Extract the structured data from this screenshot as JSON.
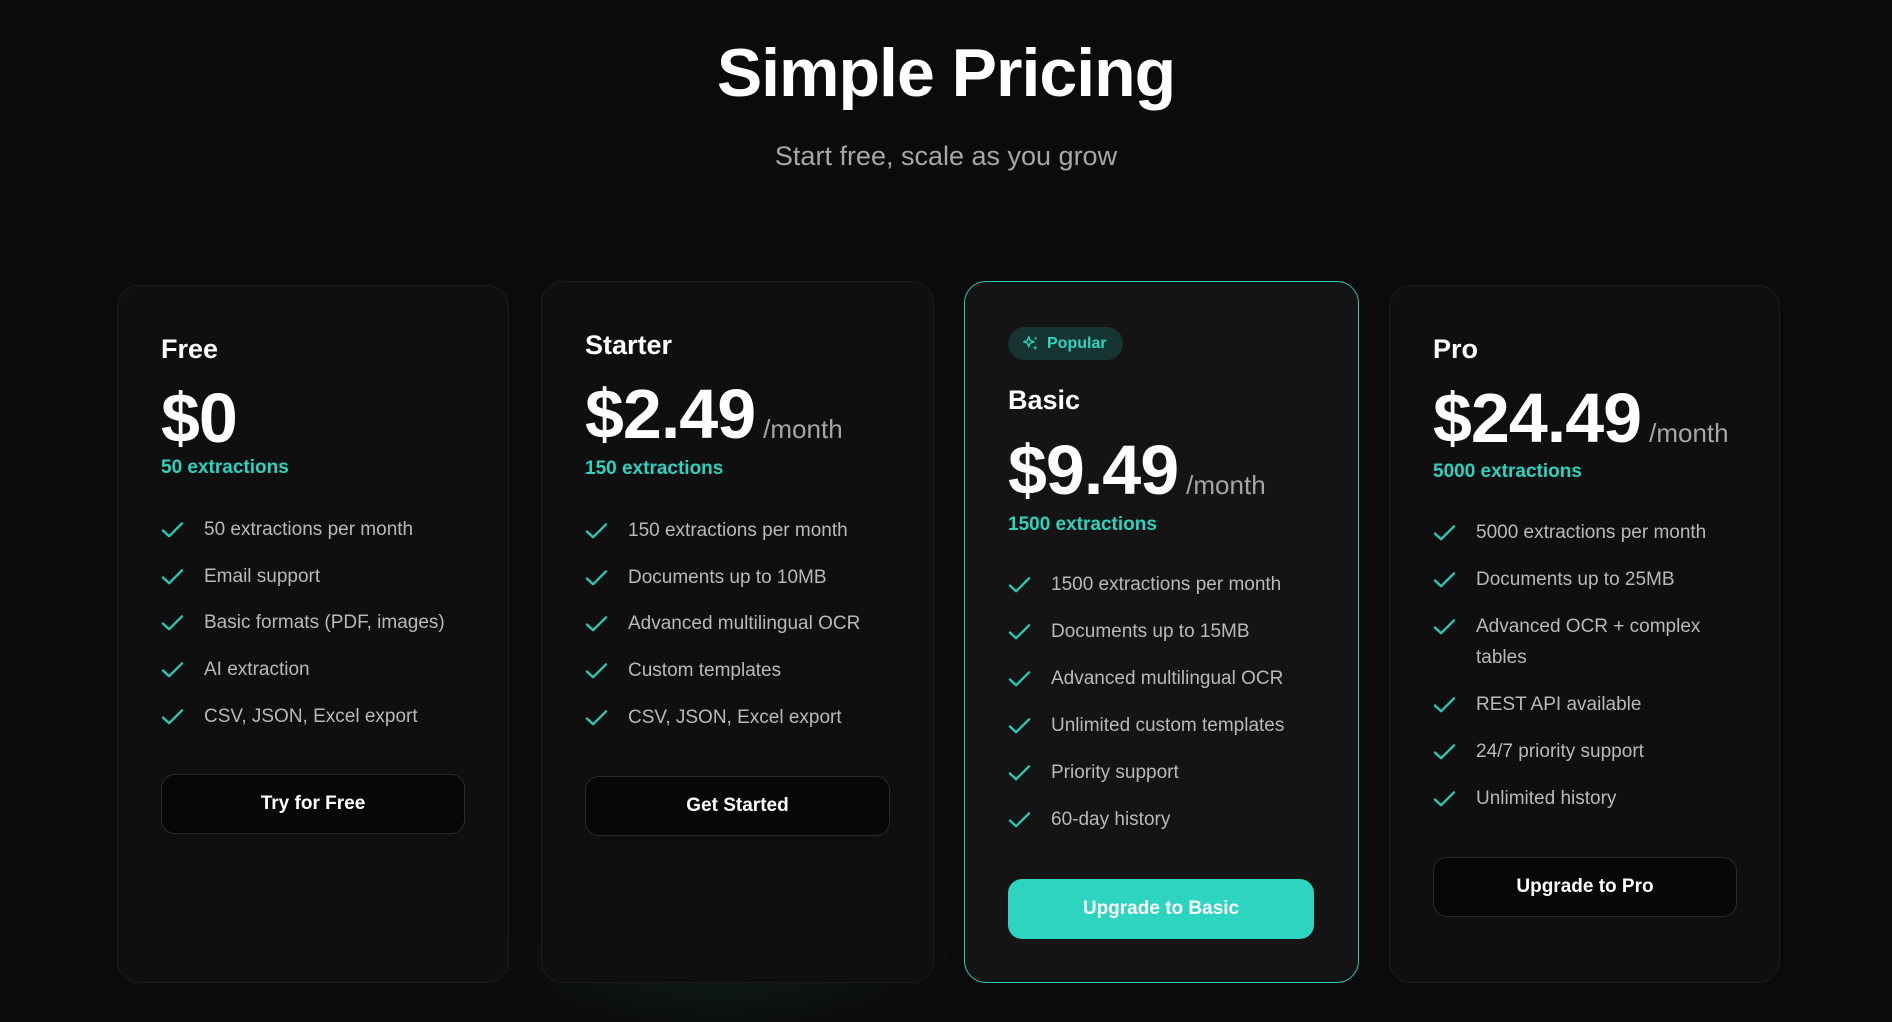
{
  "header": {
    "title": "Simple Pricing",
    "subtitle": "Start free, scale as you grow"
  },
  "colors": {
    "background": "#0b0b0b",
    "card": "#0f0f0f",
    "accent": "#2dd4c0",
    "muted_text": "#b9b9b9"
  },
  "plans": [
    {
      "name": "Free",
      "price": "$0",
      "period": "",
      "quota": "50 extractions",
      "features": [
        "50 extractions per month",
        "Email support",
        "Basic formats (PDF, images)",
        "AI extraction",
        "CSV, JSON, Excel export"
      ],
      "cta": "Try for Free"
    },
    {
      "name": "Starter",
      "price": "$2.49",
      "period": "/month",
      "quota": "150 extractions",
      "features": [
        "150 extractions per month",
        "Documents up to 10MB",
        "Advanced multilingual OCR",
        "Custom templates",
        "CSV, JSON, Excel export"
      ],
      "cta": "Get Started"
    },
    {
      "name": "Basic",
      "badge": "Popular",
      "badge_icon": "sparkle-icon",
      "price": "$9.49",
      "period": "/month",
      "quota": "1500 extractions",
      "features": [
        "1500 extractions per month",
        "Documents up to 15MB",
        "Advanced multilingual OCR",
        "Unlimited custom templates",
        "Priority support",
        "60-day history"
      ],
      "cta": "Upgrade to Basic"
    },
    {
      "name": "Pro",
      "price": "$24.49",
      "period": "/month",
      "quota": "5000 extractions",
      "features": [
        "5000 extractions per month",
        "Documents up to 25MB",
        "Advanced OCR + complex tables",
        "REST API available",
        "24/7 priority support",
        "Unlimited history"
      ],
      "cta": "Upgrade to Pro"
    }
  ]
}
